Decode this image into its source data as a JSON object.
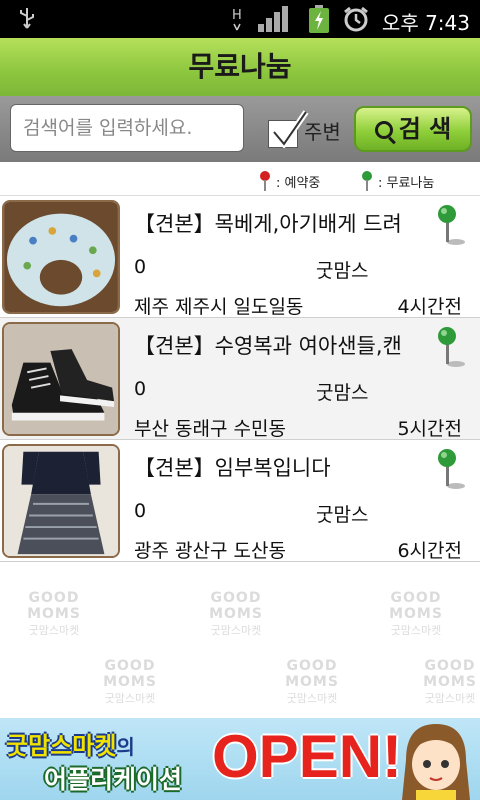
{
  "status_bar": {
    "time": "오후 7:43",
    "network": "H"
  },
  "title": "무료나눔",
  "search": {
    "placeholder": "검색어를 입력하세요.",
    "nearby_label": "주변",
    "button_label": "검 색"
  },
  "legend": {
    "reserved": ": 예약중",
    "free": ": 무료나눔"
  },
  "items": [
    {
      "title": "【견본】목베게,아기배게 드려",
      "count": "0",
      "seller": "굿맘스",
      "location": "제주 제주시 일도일동",
      "time_ago": "4시간전"
    },
    {
      "title": "【견본】수영복과 여아샌들,캔",
      "count": "0",
      "seller": "굿맘스",
      "location": "부산 동래구 수민동",
      "time_ago": "5시간전"
    },
    {
      "title": "【견본】임부복입니다",
      "count": "0",
      "seller": "굿맘스",
      "location": "광주 광산구 도산동",
      "time_ago": "6시간전"
    }
  ],
  "watermark": {
    "brand": "GOOD MOMS",
    "label": "굿맘스마켓"
  },
  "banner": {
    "line1": "굿맘스마켓",
    "line1_suffix": "의",
    "line2": "어플리케이션",
    "open": "OPEN!"
  },
  "colors": {
    "title_green": "#8cc63f",
    "pin_green": "#2e9a3a",
    "pin_red": "#d32020",
    "open_red": "#e6231c"
  }
}
